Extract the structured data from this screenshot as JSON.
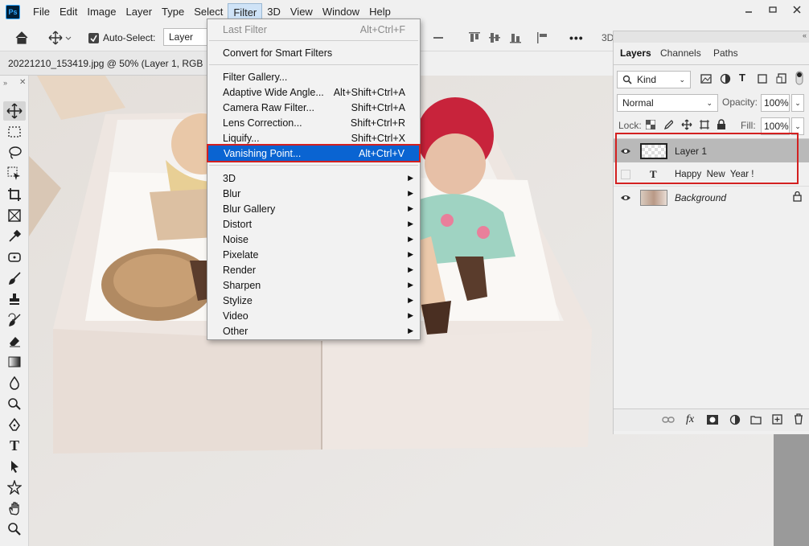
{
  "app": {
    "logo": "Ps"
  },
  "menubar": [
    "File",
    "Edit",
    "Image",
    "Layer",
    "Type",
    "Select",
    "Filter",
    "3D",
    "View",
    "Window",
    "Help"
  ],
  "window_controls": [
    "minimize-icon",
    "restore-icon",
    "close-icon"
  ],
  "options": {
    "auto_select_label": "Auto-Select:",
    "auto_select_checked": true,
    "target": "Layer",
    "more": "•••",
    "three_d": "3D"
  },
  "document_tab": {
    "title": "20221210_153419.jpg @ 50% (Layer 1, RGB"
  },
  "tools": [
    "move-icon",
    "marquee-icon",
    "lasso-icon",
    "object-select-icon",
    "crop-icon",
    "frame-icon",
    "eyedropper-icon",
    "healing-icon",
    "brush-icon",
    "stamp-icon",
    "history-brush-icon",
    "eraser-icon",
    "gradient-icon",
    "blur-icon",
    "dodge-icon",
    "pen-icon",
    "type-icon",
    "path-select-icon",
    "shape-icon",
    "hand-icon",
    "zoom-icon"
  ],
  "filter_menu": {
    "last_filter": {
      "label": "Last Filter",
      "shortcut": "Alt+Ctrl+F"
    },
    "convert": "Convert for Smart Filters",
    "group1": [
      {
        "label": "Filter Gallery...",
        "shortcut": ""
      },
      {
        "label": "Adaptive Wide Angle...",
        "shortcut": "Alt+Shift+Ctrl+A"
      },
      {
        "label": "Camera Raw Filter...",
        "shortcut": "Shift+Ctrl+A"
      },
      {
        "label": "Lens Correction...",
        "shortcut": "Shift+Ctrl+R"
      },
      {
        "label": "Liquify...",
        "shortcut": "Shift+Ctrl+X"
      },
      {
        "label": "Vanishing Point...",
        "shortcut": "Alt+Ctrl+V"
      }
    ],
    "submenus": [
      "3D",
      "Blur",
      "Blur Gallery",
      "Distort",
      "Noise",
      "Pixelate",
      "Render",
      "Sharpen",
      "Stylize",
      "Video",
      "Other"
    ],
    "highlighted": "Vanishing Point..."
  },
  "layers_panel": {
    "tabs": [
      "Layers",
      "Channels",
      "Paths"
    ],
    "kind": "Kind",
    "blend_mode": "Normal",
    "opacity_label": "Opacity:",
    "opacity": "100%",
    "lock_label": "Lock:",
    "fill_label": "Fill:",
    "fill": "100%",
    "layers": [
      {
        "name": "Layer 1",
        "visible": true,
        "selected": true
      },
      {
        "name": "Happy  New  Year !",
        "visible": false,
        "type": "text"
      },
      {
        "name": "Background",
        "visible": true,
        "locked": true
      }
    ],
    "footer_icons": [
      "link-icon",
      "fx-icon",
      "mask-icon",
      "adjustment-icon",
      "folder-icon",
      "new-layer-icon",
      "trash-icon"
    ]
  },
  "colors": {
    "highlight": "#0a64d2",
    "annotation_red": "#d32020"
  }
}
